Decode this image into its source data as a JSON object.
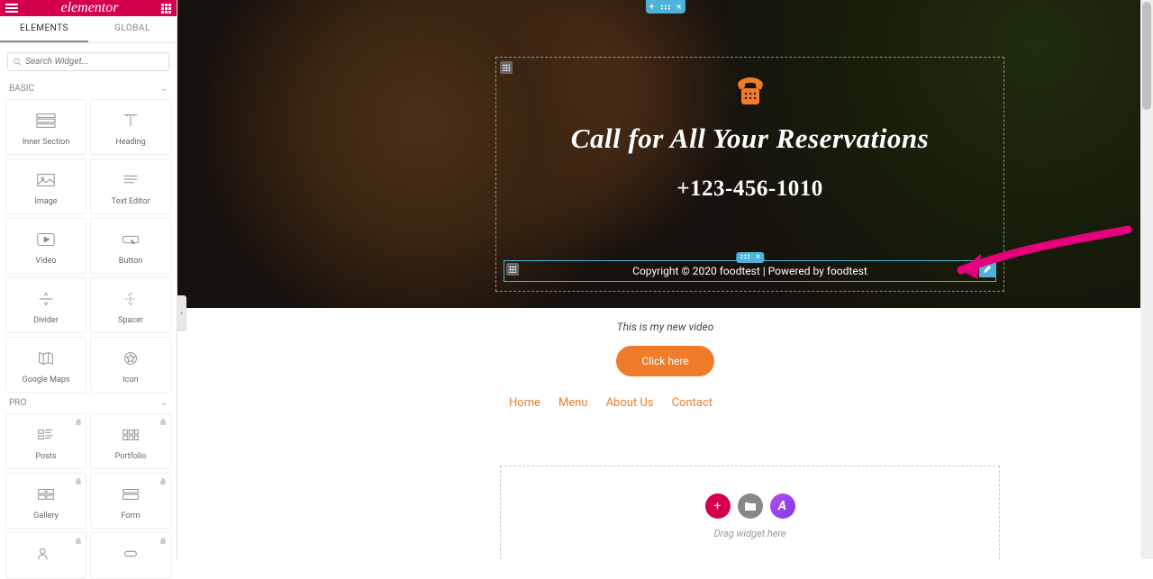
{
  "brand": "elementor",
  "tabs": {
    "elements": "ELEMENTS",
    "global": "GLOBAL"
  },
  "search": {
    "placeholder": "Search Widget..."
  },
  "categories": {
    "basic": {
      "label": "BASIC",
      "widgets": [
        {
          "name": "inner-section",
          "label": "Inner Section"
        },
        {
          "name": "heading",
          "label": "Heading"
        },
        {
          "name": "image",
          "label": "Image"
        },
        {
          "name": "text-editor",
          "label": "Text Editor"
        },
        {
          "name": "video",
          "label": "Video"
        },
        {
          "name": "button",
          "label": "Button"
        },
        {
          "name": "divider",
          "label": "Divider"
        },
        {
          "name": "spacer",
          "label": "Spacer"
        },
        {
          "name": "google-maps",
          "label": "Google Maps"
        },
        {
          "name": "icon",
          "label": "Icon"
        }
      ]
    },
    "pro": {
      "label": "PRO",
      "widgets": [
        {
          "name": "posts",
          "label": "Posts"
        },
        {
          "name": "portfolio",
          "label": "Portfolio"
        },
        {
          "name": "gallery",
          "label": "Gallery"
        },
        {
          "name": "form",
          "label": "Form"
        }
      ]
    }
  },
  "hero": {
    "title": "Call for All Your Reservations",
    "phone": "+123-456-1010",
    "footer": "Copyright © 2020 foodtest | Powered by foodtest"
  },
  "below": {
    "video_text": "This is my new video",
    "cta": "Click here",
    "nav": [
      "Home",
      "Menu",
      "About Us",
      "Contact"
    ],
    "dropzone": "Drag widget here"
  },
  "colors": {
    "accent": "#d5004d",
    "cta": "#f07c29",
    "section": "#4fb3d9"
  }
}
